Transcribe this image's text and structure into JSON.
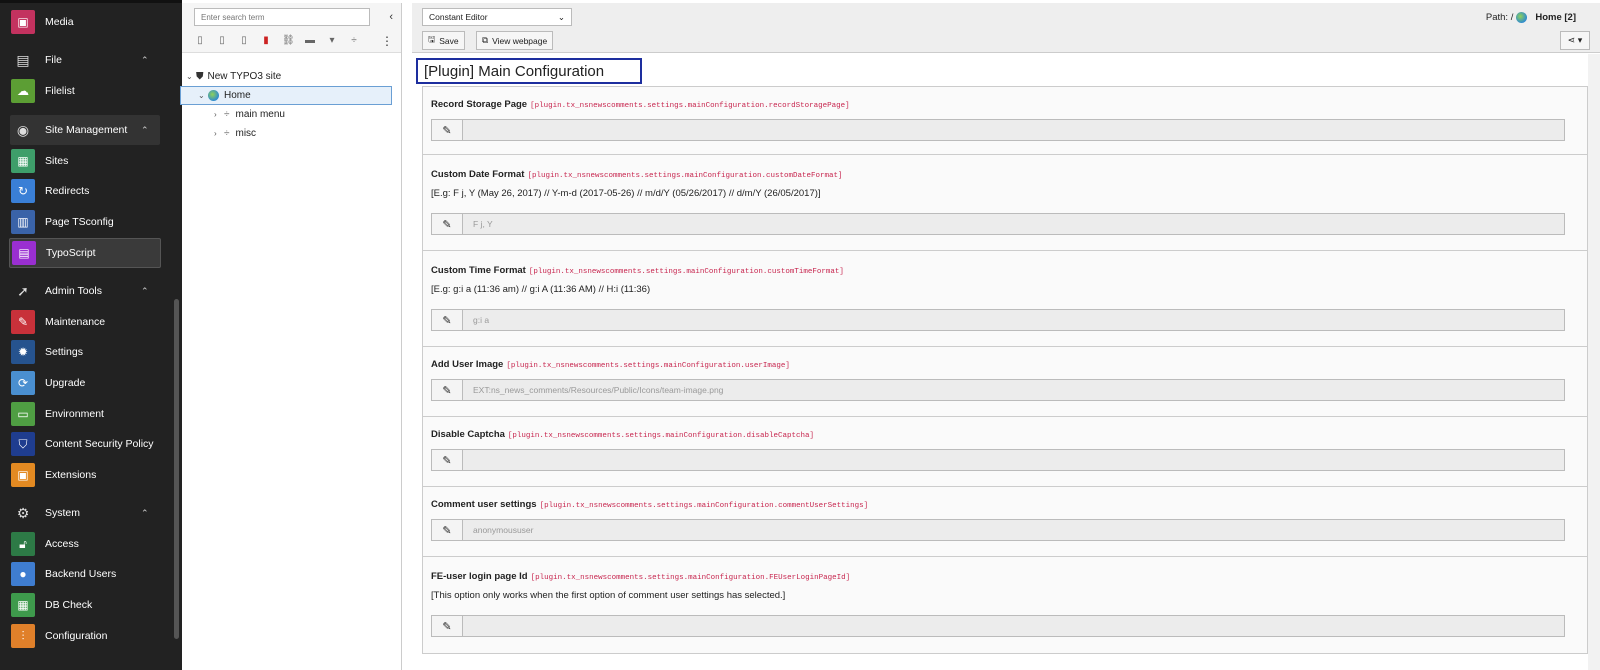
{
  "module_menu": {
    "items": [
      {
        "label": "Media",
        "icon": "media-icon",
        "color": "#c3325f"
      },
      {
        "label": "File",
        "icon": "file-icon",
        "group": true
      },
      {
        "label": "Filelist",
        "icon": "filelist-icon",
        "color": "#5c9e34"
      },
      {
        "label": "Site Management",
        "icon": "globe-icon",
        "group": true
      },
      {
        "label": "Sites",
        "icon": "sites-icon",
        "color": "#3e9e6a"
      },
      {
        "label": "Redirects",
        "icon": "redirects-icon",
        "color": "#3a7fd6"
      },
      {
        "label": "Page TSconfig",
        "icon": "page-tsconfig-icon",
        "color": "#3a63a8"
      },
      {
        "label": "TypoScript",
        "icon": "typoscript-icon",
        "color": "#9a2fd1"
      },
      {
        "label": "Admin Tools",
        "icon": "rocket-icon",
        "group": true
      },
      {
        "label": "Maintenance",
        "icon": "maintenance-icon",
        "color": "#c8313a"
      },
      {
        "label": "Settings",
        "icon": "settings-icon",
        "color": "#26538e"
      },
      {
        "label": "Upgrade",
        "icon": "upgrade-icon",
        "color": "#4a8fd0"
      },
      {
        "label": "Environment",
        "icon": "environment-icon",
        "color": "#4f9e43"
      },
      {
        "label": "Content Security Policy",
        "icon": "csp-icon",
        "color": "#1f3d8f"
      },
      {
        "label": "Extensions",
        "icon": "extensions-icon",
        "color": "#e38a22"
      },
      {
        "label": "System",
        "icon": "gear-icon",
        "group": true
      },
      {
        "label": "Access",
        "icon": "access-icon",
        "color": "#2d7a46"
      },
      {
        "label": "Backend Users",
        "icon": "backend-users-icon",
        "color": "#3f7dd0"
      },
      {
        "label": "DB Check",
        "icon": "db-check-icon",
        "color": "#3e9a4c"
      },
      {
        "label": "Configuration",
        "icon": "configuration-icon",
        "color": "#e0802a"
      }
    ]
  },
  "page_tree": {
    "search_placeholder": "Enter search term",
    "nodes": [
      {
        "label": "New TYPO3 site"
      },
      {
        "label": "Home"
      },
      {
        "label": "main menu"
      },
      {
        "label": "misc"
      }
    ]
  },
  "header": {
    "select_value": "Constant Editor",
    "save_label": "Save",
    "view_label": "View webpage",
    "path_prefix": "Path: /",
    "path_page": "Home [2]"
  },
  "category_title": "[Plugin] Main Configuration",
  "sections": [
    {
      "title": "Record Storage Page",
      "key": "[plugin.tx_nsnewscomments.settings.mainConfiguration.recordStoragePage]",
      "desc": "",
      "value": ""
    },
    {
      "title": "Custom Date Format",
      "key": "[plugin.tx_nsnewscomments.settings.mainConfiguration.customDateFormat]",
      "desc": "[E.g: F j, Y (May 26, 2017) // Y-m-d (2017-05-26) // m/d/Y (05/26/2017) // d/m/Y (26/05/2017)]",
      "value": "F j, Y"
    },
    {
      "title": "Custom Time Format",
      "key": "[plugin.tx_nsnewscomments.settings.mainConfiguration.customTimeFormat]",
      "desc": "[E.g: g:i a (11:36 am) // g:i A (11:36 AM) // H:i (11:36)",
      "value": "g:i a"
    },
    {
      "title": "Add User Image",
      "key": "[plugin.tx_nsnewscomments.settings.mainConfiguration.userImage]",
      "desc": "",
      "value": "EXT:ns_news_comments/Resources/Public/Icons/team-image.png"
    },
    {
      "title": "Disable Captcha",
      "key": "[plugin.tx_nsnewscomments.settings.mainConfiguration.disableCaptcha]",
      "desc": "",
      "value": ""
    },
    {
      "title": "Comment user settings",
      "key": "[plugin.tx_nsnewscomments.settings.mainConfiguration.commentUserSettings]",
      "desc": "",
      "value": "anonymoususer"
    },
    {
      "title": "FE-user login page Id",
      "key": "[plugin.tx_nsnewscomments.settings.mainConfiguration.FEUserLoginPageId]",
      "desc": "[This option only works when the first option of comment user settings has selected.]",
      "value": ""
    }
  ]
}
